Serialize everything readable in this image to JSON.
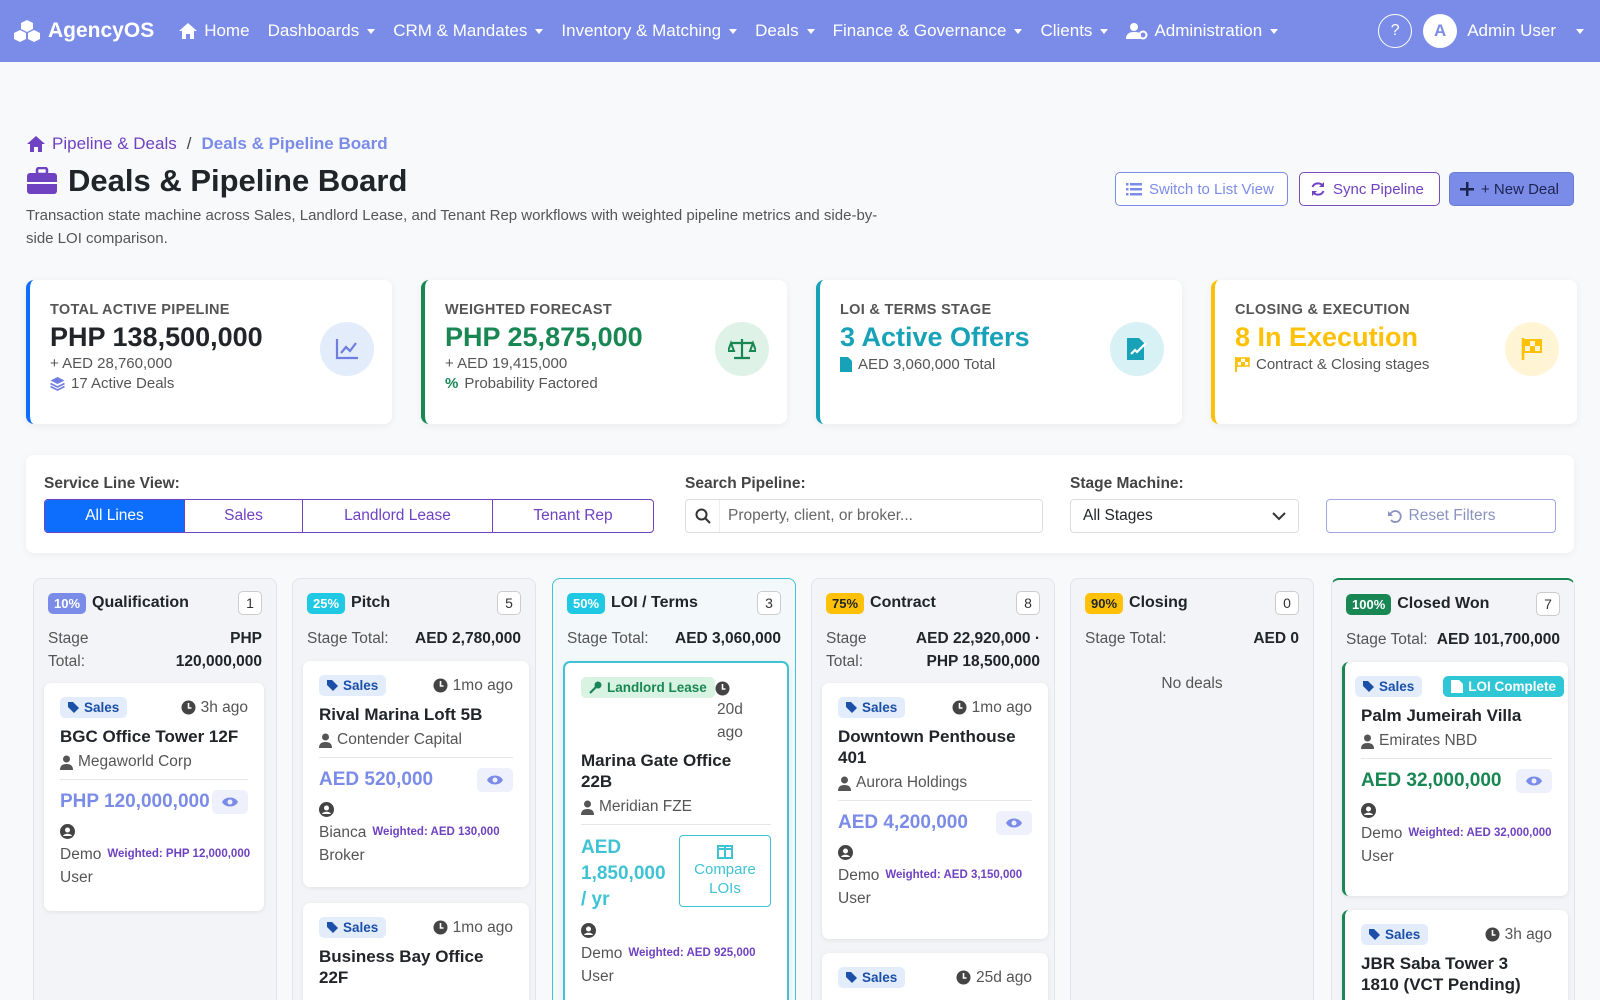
{
  "nav": {
    "brand": "AgencyOS",
    "home": "Home",
    "items": [
      "Dashboards",
      "CRM & Mandates",
      "Inventory & Matching",
      "Deals",
      "Finance & Governance",
      "Clients"
    ],
    "admin": "Administration",
    "help": "?",
    "avatar_letter": "A",
    "user": "Admin User"
  },
  "breadcrumb": {
    "root": "Pipeline & Deals",
    "sep": "/",
    "current": "Deals & Pipeline Board"
  },
  "page": {
    "title": "Deals & Pipeline Board",
    "description": "Transaction state machine across Sales, Landlord Lease, and Tenant Rep workflows with weighted pipeline metrics and side-by-side LOI comparison."
  },
  "actions": {
    "list_view": "Switch to List View",
    "sync": "Sync Pipeline",
    "new_deal": "+ New Deal"
  },
  "stats": [
    {
      "label": "TOTAL ACTIVE PIPELINE",
      "value": "PHP 138,500,000",
      "sub": "+ AED 28,760,000",
      "sub2": "17 Active Deals",
      "color": "#0d6efd"
    },
    {
      "label": "WEIGHTED FORECAST",
      "value": "PHP 25,875,000",
      "sub": "+ AED 19,415,000",
      "sub2": "Probability Factored",
      "color": "#198754"
    },
    {
      "label": "LOI & TERMS STAGE",
      "value": "3 Active Offers",
      "sub2": "AED 3,060,000 Total",
      "color": "#17a2b8"
    },
    {
      "label": "CLOSING & EXECUTION",
      "value": "8 In Execution",
      "sub2": "Contract & Closing stages",
      "color": "#ffc107"
    }
  ],
  "filters": {
    "service_label": "Service Line View:",
    "service_options": [
      "All Lines",
      "Sales",
      "Landlord Lease",
      "Tenant Rep"
    ],
    "search_label": "Search Pipeline:",
    "search_placeholder": "Property, client, or broker...",
    "stage_label": "Stage Machine:",
    "stage_value": "All Stages",
    "reset": "Reset Filters"
  },
  "columns": [
    {
      "pct": "10%",
      "name": "Qualification",
      "count": "1",
      "total_label_a": "Stage",
      "total_label_b": "Total:",
      "total_a": "PHP",
      "total_b": "120,000,000",
      "cards": [
        {
          "badge": "Sales",
          "ago": "3h ago",
          "title": "BGC Office Tower 12F",
          "client": "Megaworld Corp",
          "price": "PHP 120,000,000",
          "owner_a": "Demo",
          "owner_b": "User",
          "weighted": "Weighted: PHP 12,000,000"
        }
      ]
    },
    {
      "pct": "25%",
      "name": "Pitch",
      "count": "5",
      "total_label": "Stage Total:",
      "total": "AED 2,780,000",
      "cards": [
        {
          "badge": "Sales",
          "ago": "1mo ago",
          "title": "Rival Marina Loft 5B",
          "client": "Contender Capital",
          "price": "AED 520,000",
          "owner_a": "Bianca",
          "owner_b": "Broker",
          "weighted": "Weighted: AED 130,000"
        },
        {
          "badge": "Sales",
          "ago": "1mo ago",
          "title_a": "Business Bay Office",
          "title_b": "22F"
        }
      ]
    },
    {
      "pct": "50%",
      "name": "LOI / Terms",
      "count": "3",
      "total_label": "Stage Total:",
      "total": "AED 3,060,000",
      "cards": [
        {
          "badge": "Landlord Lease",
          "ago_a": "20d",
          "ago_b": "ago",
          "title_a": "Marina Gate Office",
          "title_b": "22B",
          "client": "Meridian FZE",
          "price_a": "AED",
          "price_b": "1,850,000",
          "price_c": "/ yr",
          "compare_a": "Compare",
          "compare_b": "LOIs",
          "owner_a": "Demo",
          "owner_b": "User",
          "weighted": "Weighted: AED 925,000"
        }
      ]
    },
    {
      "pct": "75%",
      "name": "Contract",
      "count": "8",
      "total_label_a": "Stage",
      "total_label_b": "Total:",
      "total_a": "AED 22,920,000 ·",
      "total_b": "PHP 18,500,000",
      "cards": [
        {
          "badge": "Sales",
          "ago": "1mo ago",
          "title_a": "Downtown Penthouse",
          "title_b": "401",
          "client": "Aurora Holdings",
          "price": "AED 4,200,000",
          "owner_a": "Demo",
          "owner_b": "User",
          "weighted": "Weighted: AED 3,150,000"
        },
        {
          "badge": "Sales",
          "ago": "25d ago"
        }
      ]
    },
    {
      "pct": "90%",
      "name": "Closing",
      "count": "0",
      "total_label": "Stage Total:",
      "total": "AED 0",
      "empty": "No deals"
    },
    {
      "pct": "100%",
      "name": "Closed Won",
      "count": "7",
      "total_label": "Stage Total:",
      "total": "AED 101,700,000",
      "cards": [
        {
          "badge": "Sales",
          "badge2": "LOI Complete",
          "title": "Palm Jumeirah Villa",
          "client": "Emirates NBD",
          "price": "AED 32,000,000",
          "owner_a": "Demo",
          "owner_b": "User",
          "weighted": "Weighted: AED 32,000,000"
        },
        {
          "badge": "Sales",
          "ago": "3h ago",
          "title_a": "JBR Saba Tower 3",
          "title_b": "1810 (VCT Pending)"
        }
      ]
    }
  ]
}
